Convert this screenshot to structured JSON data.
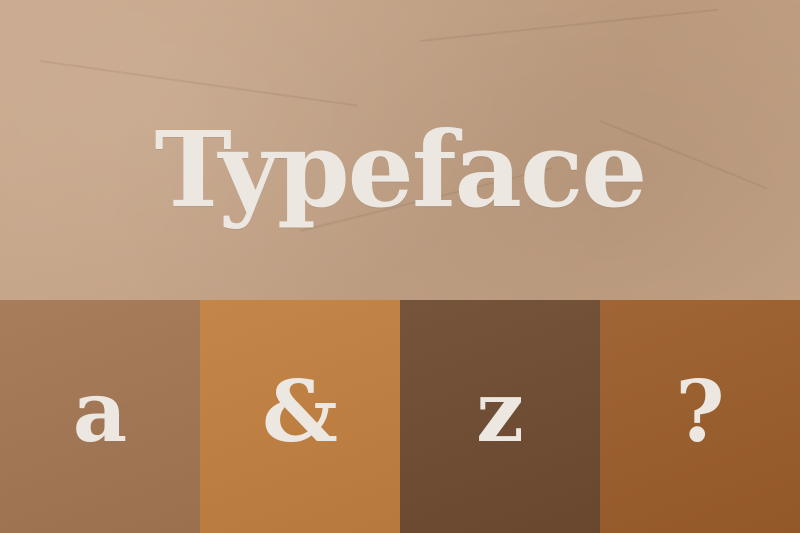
{
  "title": "Typeface",
  "colors": {
    "background": "#c5a284",
    "text": "#ece7e0"
  },
  "swatches": [
    {
      "glyph": "a",
      "color": "#a37653"
    },
    {
      "glyph": "&",
      "color": "#c17f3f"
    },
    {
      "glyph": "z",
      "color": "#6e4b31"
    },
    {
      "glyph": "?",
      "color": "#9b5d2a"
    }
  ]
}
